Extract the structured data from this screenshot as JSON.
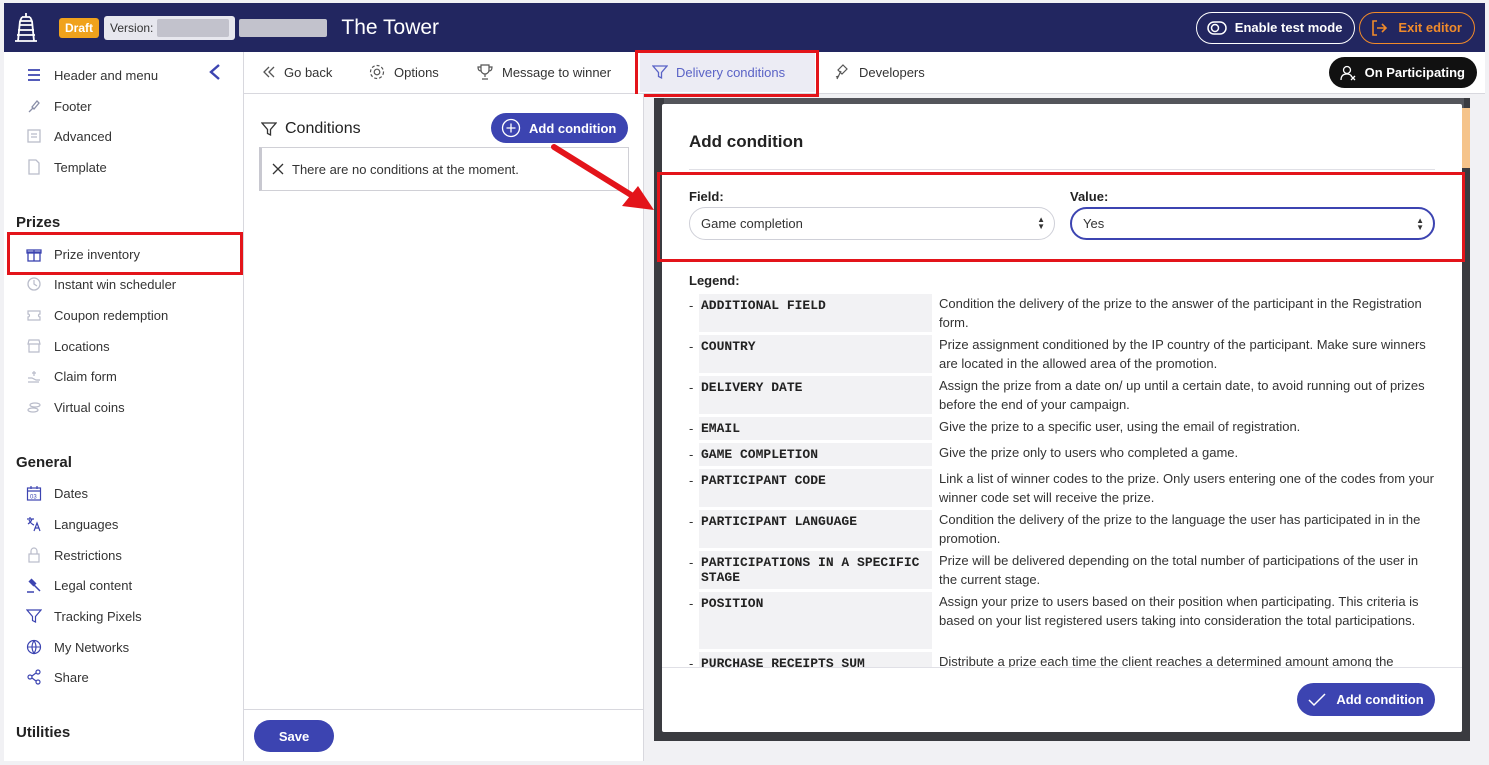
{
  "header": {
    "draft_badge": "Draft",
    "version_label": "Version:",
    "title": "The Tower",
    "test_mode_label": "Enable test mode",
    "exit_label": "Exit editor"
  },
  "sidebar": {
    "top_items": [
      {
        "label": "Header and menu",
        "icon": "menu-icon"
      },
      {
        "label": "Footer",
        "icon": "brush-icon"
      },
      {
        "label": "Advanced",
        "icon": "document-icon"
      },
      {
        "label": "Template",
        "icon": "file-icon"
      }
    ],
    "prizes_heading": "Prizes",
    "prizes_items": [
      {
        "label": "Prize inventory",
        "icon": "gift-icon"
      },
      {
        "label": "Instant win scheduler",
        "icon": "clock-icon"
      },
      {
        "label": "Coupon redemption",
        "icon": "coupon-icon"
      },
      {
        "label": "Locations",
        "icon": "store-icon"
      },
      {
        "label": "Claim form",
        "icon": "hand-icon"
      },
      {
        "label": "Virtual coins",
        "icon": "coins-icon"
      }
    ],
    "general_heading": "General",
    "general_items": [
      {
        "label": "Dates",
        "icon": "calendar-icon"
      },
      {
        "label": "Languages",
        "icon": "translate-icon"
      },
      {
        "label": "Restrictions",
        "icon": "lock-icon"
      },
      {
        "label": "Legal content",
        "icon": "gavel-icon"
      },
      {
        "label": "Tracking Pixels",
        "icon": "filter-icon"
      },
      {
        "label": "My Networks",
        "icon": "globe-icon"
      },
      {
        "label": "Share",
        "icon": "share-icon"
      }
    ],
    "utilities_heading": "Utilities"
  },
  "tabs": {
    "go_back": "Go back",
    "options": "Options",
    "message_to_winner": "Message to winner",
    "delivery_conditions": "Delivery conditions",
    "developers": "Developers",
    "on_participating": "On Participating"
  },
  "conditions_panel": {
    "title": "Conditions",
    "add_button": "Add condition",
    "empty_message": "There are no conditions at the moment.",
    "save_button": "Save"
  },
  "modal": {
    "title": "Add condition",
    "field_label": "Field:",
    "field_value": "Game completion",
    "value_label": "Value:",
    "value_value": "Yes",
    "legend_label": "Legend:",
    "legend": [
      {
        "key": "ADDITIONAL FIELD",
        "desc": "Condition the delivery of the prize to the answer of the participant in the Registration form."
      },
      {
        "key": "COUNTRY",
        "desc": "Prize assignment conditioned by the IP country of the participant. Make sure winners are located in the allowed area of the promotion."
      },
      {
        "key": "DELIVERY DATE",
        "desc": "Assign the prize from a date on/ up until a certain date, to avoid running out of prizes before the end of your campaign."
      },
      {
        "key": "EMAIL",
        "desc": "Give the prize to a specific user, using the email of registration."
      },
      {
        "key": "GAME COMPLETION",
        "desc": "Give the prize only to users who completed a game."
      },
      {
        "key": "PARTICIPANT CODE",
        "desc": "Link a list of winner codes to the prize. Only users entering one of the codes from your winner code set will receive the prize."
      },
      {
        "key": "PARTICIPANT LANGUAGE",
        "desc": "Condition the delivery of the prize to the language the user has participated in in the promotion."
      },
      {
        "key": "PARTICIPATIONS IN A SPECIFIC STAGE",
        "desc": "Prize will be delivered depending on the total number of participations of the user in the current stage."
      },
      {
        "key": "POSITION",
        "desc": "Assign your prize to users based on their position when participating. This criteria is based on your list registered users taking into consideration the total participations."
      },
      {
        "key": "PURCHASE RECEIPTS SUM",
        "desc": "Distribute a prize each time the client reaches a determined amount among the"
      }
    ],
    "submit_button": "Add condition"
  },
  "colors": {
    "topbar": "#222660",
    "accent": "#3c44b1",
    "draft": "#f0a21c",
    "exit": "#f08a2a",
    "highlight": "#e3141a"
  }
}
